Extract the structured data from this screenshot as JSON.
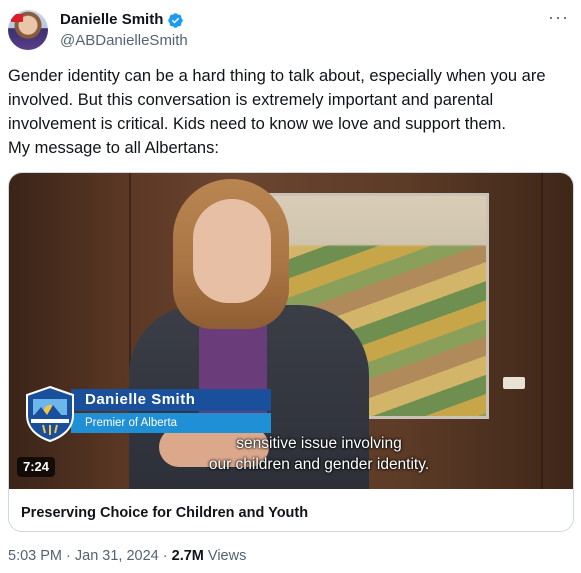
{
  "author": {
    "display_name": "Danielle Smith",
    "handle": "@ABDanielleSmith",
    "verified_icon": "verified-badge-icon",
    "verified_color": "#1d9bf0"
  },
  "more_label": "···",
  "tweet_text": "Gender identity can be a hard thing to talk about, especially when you are involved. But this conversation is extremely important and parental involvement is critical. Kids need to know we love and support them.\nMy message to all Albertans:",
  "video": {
    "lower_third_name": "Danielle Smith",
    "lower_third_title": "Premier of Alberta",
    "caption_line1": "sensitive issue involving",
    "caption_line2": "our children and gender identity.",
    "duration": "7:24",
    "card_title": "Preserving Choice for Children and Youth"
  },
  "meta": {
    "time": "5:03 PM",
    "separator": " · ",
    "date": "Jan 31, 2024",
    "views_count": "2.7M",
    "views_label": " Views"
  },
  "colors": {
    "text_primary": "#0f1419",
    "text_secondary": "#536471",
    "border": "#cfd9de",
    "lower_third_dark": "#1a4f9c",
    "lower_third_light": "#1f8fd6"
  }
}
